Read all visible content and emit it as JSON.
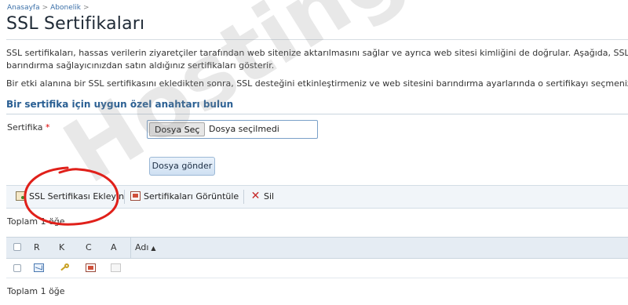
{
  "breadcrumb": {
    "items": [
      "Anasayfa",
      "Abonelik"
    ],
    "separator": ">"
  },
  "page": {
    "title": "SSL Sertifikaları"
  },
  "description": {
    "line1": "SSL sertifikaları, hassas verilerin ziyaretçiler tarafından web sitenize aktarılmasını sağlar ve ayrıca web sitesi kimliğini de doğrular. Aşağıda, SSL sertif",
    "line2": "barındırma sağlayıcınızdan satın aldığınız sertifikaları gösterir.",
    "line3": "Bir etki alanına bir SSL sertifikasını ekledikten sonra, SSL desteğini etkinleştirmeniz ve web sitesini barındırma ayarlarında o sertifikayı seçmeniz gere"
  },
  "section": {
    "title": "Bir sertifika için uygun özel anahtarı bulun"
  },
  "form": {
    "certificate_label": "Sertifika",
    "required_mark": "*",
    "file_button_label": "Dosya Seç",
    "file_status": "Dosya seçilmedi",
    "upload_button_label": "Dosya gönder"
  },
  "toolbar": {
    "items": [
      {
        "label": "SSL Sertifikası Ekleyin",
        "icon": "certificate-add-icon"
      },
      {
        "label": "Sertifikaları Görüntüle",
        "icon": "certificate-view-icon"
      },
      {
        "label": "Sil",
        "icon": "delete-icon"
      }
    ]
  },
  "list": {
    "total_top": "Toplam 1 öğe",
    "total_bottom": "Toplam 1 öğe",
    "columns": [
      "R",
      "K",
      "C",
      "A",
      "Adı"
    ],
    "sort_indicator": "▲",
    "row_icons": [
      "mail-icon",
      "key-icon",
      "certificate-icon",
      "ca-certificate-icon"
    ]
  },
  "watermark": {
    "text": "HostingALL"
  },
  "colors": {
    "link": "#3a6fa8",
    "section_title": "#2a5f93",
    "toolbar_bg": "#f1f5f9",
    "table_header_bg": "#e5ecf3",
    "annotation": "#e0201a",
    "delete": "#c62828"
  }
}
